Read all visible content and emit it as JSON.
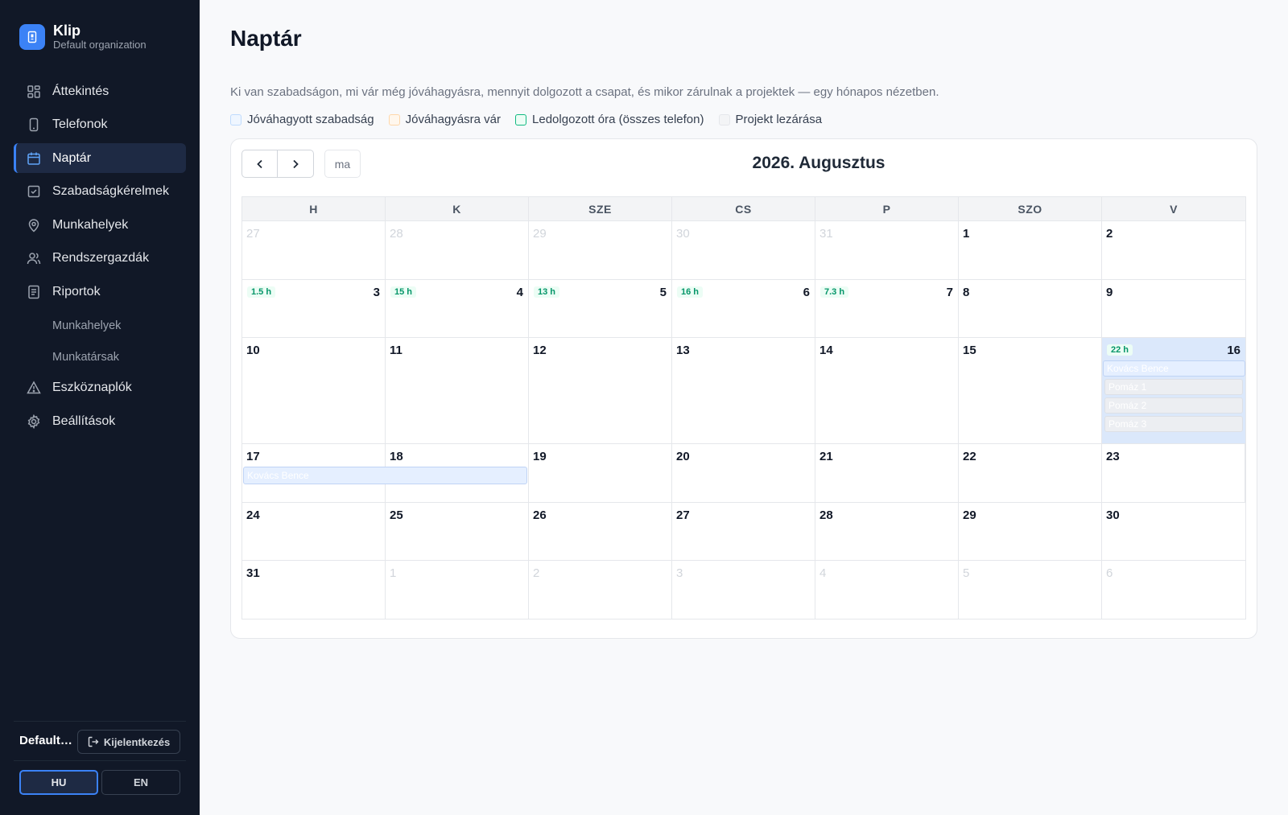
{
  "app": {
    "name": "Klip",
    "org": "Default organization"
  },
  "sidebar": {
    "items": [
      {
        "label": "Áttekintés",
        "icon": "dashboard-icon"
      },
      {
        "label": "Telefonok",
        "icon": "phone-icon"
      },
      {
        "label": "Naptár",
        "icon": "calendar-icon",
        "active": true
      },
      {
        "label": "Szabadságkérelmek",
        "icon": "check-square-icon"
      },
      {
        "label": "Munkahelyek",
        "icon": "map-pin-icon"
      },
      {
        "label": "Rendszergazdák",
        "icon": "users-icon"
      },
      {
        "label": "Riportok",
        "icon": "document-icon"
      }
    ],
    "subitems": [
      {
        "label": "Munkahelyek"
      },
      {
        "label": "Munkatársak"
      }
    ],
    "items_after": [
      {
        "label": "Eszköznaplók",
        "icon": "warning-icon"
      },
      {
        "label": "Beállítások",
        "icon": "gear-icon"
      }
    ],
    "footer": {
      "user": "Default organization",
      "logout": "Kijelentkezés"
    },
    "lang": {
      "hu": "HU",
      "en": "EN",
      "selected": "HU"
    }
  },
  "main": {
    "title": "Naptár",
    "subtitle": "Ki van szabadságon, mi vár még jóváhagyásra, mennyit dolgozott a csapat, és mikor zárulnak a projektek — egy hónapos nézetben.",
    "legend": [
      "Jóváhagyott szabadság",
      "Jóváhagyásra vár",
      "Ledolgozott óra (összes telefon)",
      "Projekt lezárása"
    ]
  },
  "calendar": {
    "month_title": "2026. Augusztus",
    "today_label": "ma",
    "weekdays": [
      "H",
      "K",
      "SZE",
      "CS",
      "P",
      "SZO",
      "V"
    ],
    "weeks": [
      {
        "days": [
          {
            "n": "27",
            "other": true
          },
          {
            "n": "28",
            "other": true
          },
          {
            "n": "29",
            "other": true
          },
          {
            "n": "30",
            "other": true
          },
          {
            "n": "31",
            "other": true
          },
          {
            "n": "1"
          },
          {
            "n": "2"
          }
        ]
      },
      {
        "days": [
          {
            "n": "3",
            "hours": "1.5 h"
          },
          {
            "n": "4",
            "hours": "15 h"
          },
          {
            "n": "5",
            "hours": "13 h"
          },
          {
            "n": "6",
            "hours": "16 h"
          },
          {
            "n": "7",
            "hours": "7.3 h"
          },
          {
            "n": "8"
          },
          {
            "n": "9"
          }
        ]
      },
      {
        "days": [
          {
            "n": "10"
          },
          {
            "n": "11"
          },
          {
            "n": "12"
          },
          {
            "n": "13"
          },
          {
            "n": "14"
          },
          {
            "n": "15"
          },
          {
            "n": "16",
            "hours": "22 h",
            "highlight": true,
            "events": [
              {
                "label": "Kovács Bence",
                "kind": "leave"
              },
              {
                "label": "Pomáz 1",
                "kind": "project"
              },
              {
                "label": "Pomáz 2",
                "kind": "project"
              },
              {
                "label": "Pomáz 3",
                "kind": "project"
              }
            ]
          }
        ]
      },
      {
        "days": [
          {
            "n": "17"
          },
          {
            "n": "18"
          },
          {
            "n": "19"
          },
          {
            "n": "20"
          },
          {
            "n": "21"
          },
          {
            "n": "22"
          },
          {
            "n": "23"
          }
        ],
        "span_event": {
          "label": "Kovács Bence"
        }
      },
      {
        "days": [
          {
            "n": "24"
          },
          {
            "n": "25"
          },
          {
            "n": "26"
          },
          {
            "n": "27"
          },
          {
            "n": "28"
          },
          {
            "n": "29"
          },
          {
            "n": "30"
          }
        ]
      },
      {
        "days": [
          {
            "n": "31"
          },
          {
            "n": "1",
            "other": true
          },
          {
            "n": "2",
            "other": true
          },
          {
            "n": "3",
            "other": true
          },
          {
            "n": "4",
            "other": true
          },
          {
            "n": "5",
            "other": true
          },
          {
            "n": "6",
            "other": true
          }
        ]
      }
    ]
  },
  "colors": {
    "accent": "#3b82f6",
    "sidebar_bg": "#111827",
    "hours_green": "#059669"
  }
}
